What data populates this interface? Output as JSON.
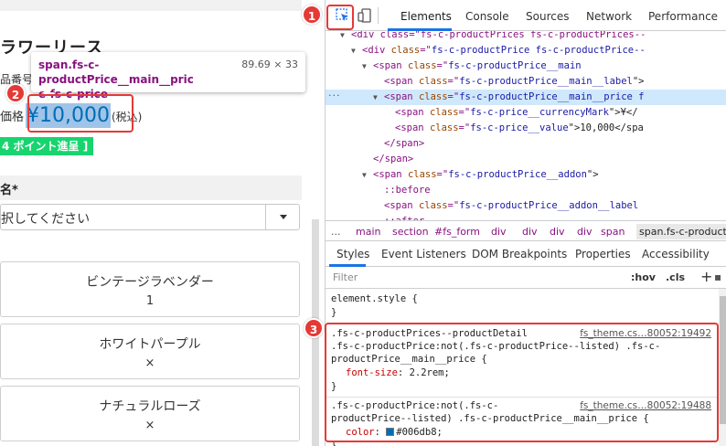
{
  "page": {
    "product_title": "ラワーリース",
    "product_number_label": "品番号",
    "price_label": "価格",
    "price_currency": "¥",
    "price_value": "10,000",
    "price_tax": "(税込)",
    "points_badge": "4 ポイント進呈 ]",
    "variation_header": "名*",
    "select_placeholder": "択してください",
    "variations": [
      {
        "name": "ビンテージラベンダー",
        "stock": "1"
      },
      {
        "name": "ホワイトパープル",
        "stock": "×"
      },
      {
        "name": "ナチュラルローズ",
        "stock": "×"
      }
    ]
  },
  "tooltip": {
    "selector_line1": "span.fs-c-productPrice__main__pric",
    "selector_line2": "e.fs-c-price",
    "dimensions": "89.69 × 33"
  },
  "devtools": {
    "tabs": [
      "Elements",
      "Console",
      "Sources",
      "Network",
      "Performance"
    ],
    "active_tab": "Elements",
    "dom_lines": [
      {
        "indent": 8,
        "arrow": "▼",
        "html": "<div class=\"fs-c-productPrices fs-c-productPrices--",
        "cut": true
      },
      {
        "indent": 9,
        "arrow": "▼",
        "tag": "div",
        "attr": "class",
        "val": "fs-c-productPrice fs-c-productPrice--"
      },
      {
        "indent": 10,
        "arrow": "▼",
        "tag": "span",
        "attr": "class",
        "val": "fs-c-productPrice__main"
      },
      {
        "indent": 11,
        "arrow": "",
        "tag": "span",
        "attr": "class",
        "val": "fs-c-productPrice__main__label",
        "rest": "\">"
      },
      {
        "indent": 11,
        "arrow": "▼",
        "tag": "span",
        "attr": "class",
        "val": "fs-c-productPrice__main__price f",
        "selected": true
      },
      {
        "indent": 12,
        "arrow": "",
        "tag": "span",
        "attr": "class",
        "val": "fs-c-price__currencyMark",
        "rest": "\">¥</"
      },
      {
        "indent": 12,
        "arrow": "",
        "tag": "span",
        "attr": "class",
        "val": "fs-c-price__value",
        "rest": "\">10,000</spa"
      },
      {
        "indent": 11,
        "arrow": "",
        "close": "</span>"
      },
      {
        "indent": 10,
        "arrow": "",
        "close": "</span>"
      },
      {
        "indent": 10,
        "arrow": "▼",
        "tag": "span",
        "attr": "class",
        "val": "fs-c-productPrice__addon",
        "rest": "\">"
      },
      {
        "indent": 11,
        "arrow": "",
        "pseudo": "::before"
      },
      {
        "indent": 11,
        "arrow": "",
        "tag": "span",
        "attr": "class",
        "val": "fs-c-productPrice__addon__label"
      },
      {
        "indent": 11,
        "arrow": "",
        "pseudo": "::after"
      }
    ],
    "breadcrumbs": [
      "...",
      "main",
      "section",
      "#fs_form",
      "div",
      "div",
      "div",
      "div",
      "span",
      "span.fs-c-productI"
    ],
    "sub_tabs": [
      "Styles",
      "Event Listeners",
      "DOM Breakpoints",
      "Properties",
      "Accessibility"
    ],
    "filter_placeholder": "Filter",
    "hov": ":hov",
    "cls": ".cls",
    "plus": "+",
    "element_style": "element.style {",
    "close_brace": "}",
    "rule1": {
      "line1": ".fs-c-productPrices--productDetail",
      "link": "fs_theme.cs…80052:19492",
      "line2": ".fs-c-productPrice:not(.fs-c-productPrice--listed) .fs-c-",
      "line3": "productPrice__main__price {",
      "prop": "font-size",
      "value": "2.2rem;"
    },
    "rule2": {
      "line1": ".fs-c-productPrice:not(.fs-c-",
      "link": "fs_theme.cs…80052:19488",
      "line2": "productPrice--listed) .fs-c-productPrice__main__price {",
      "prop": "color",
      "value": "#006db8;"
    }
  },
  "annotations": [
    "1",
    "2",
    "3"
  ],
  "colors": {
    "annotation": "#e53935",
    "price": "#006db8",
    "points": "#18d46f",
    "accent": "#1a73e8"
  }
}
